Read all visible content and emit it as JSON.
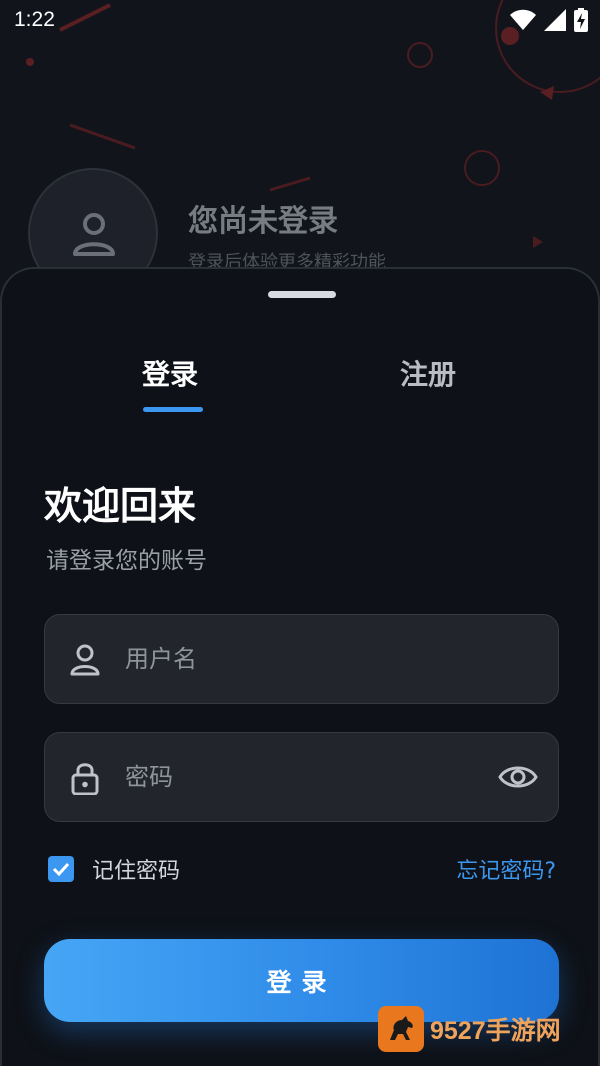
{
  "status_bar": {
    "time": "1:22",
    "icons": [
      "wifi-icon",
      "cellular-signal-icon",
      "battery-charging-icon"
    ]
  },
  "profile": {
    "title": "您尚未登录",
    "subtitle": "登录后体验更多精彩功能"
  },
  "tabs": [
    {
      "label": "登录",
      "active": true
    },
    {
      "label": "注册",
      "active": false
    }
  ],
  "welcome": {
    "title": "欢迎回来",
    "subtitle": "请登录您的账号"
  },
  "form": {
    "username": {
      "value": "",
      "placeholder": "用户名",
      "icon": "user-icon"
    },
    "password": {
      "value": "",
      "placeholder": "密码",
      "icon": "lock-icon",
      "toggle_icon": "eye-icon"
    },
    "remember": {
      "label": "记住密码",
      "checked": true
    },
    "forgot_label": "忘记密码?",
    "submit_label": "登录"
  },
  "watermark": {
    "text": "9527手游网"
  },
  "colors": {
    "accent": "#3b97f0",
    "background": "#0e1117",
    "field": "#22252c"
  }
}
